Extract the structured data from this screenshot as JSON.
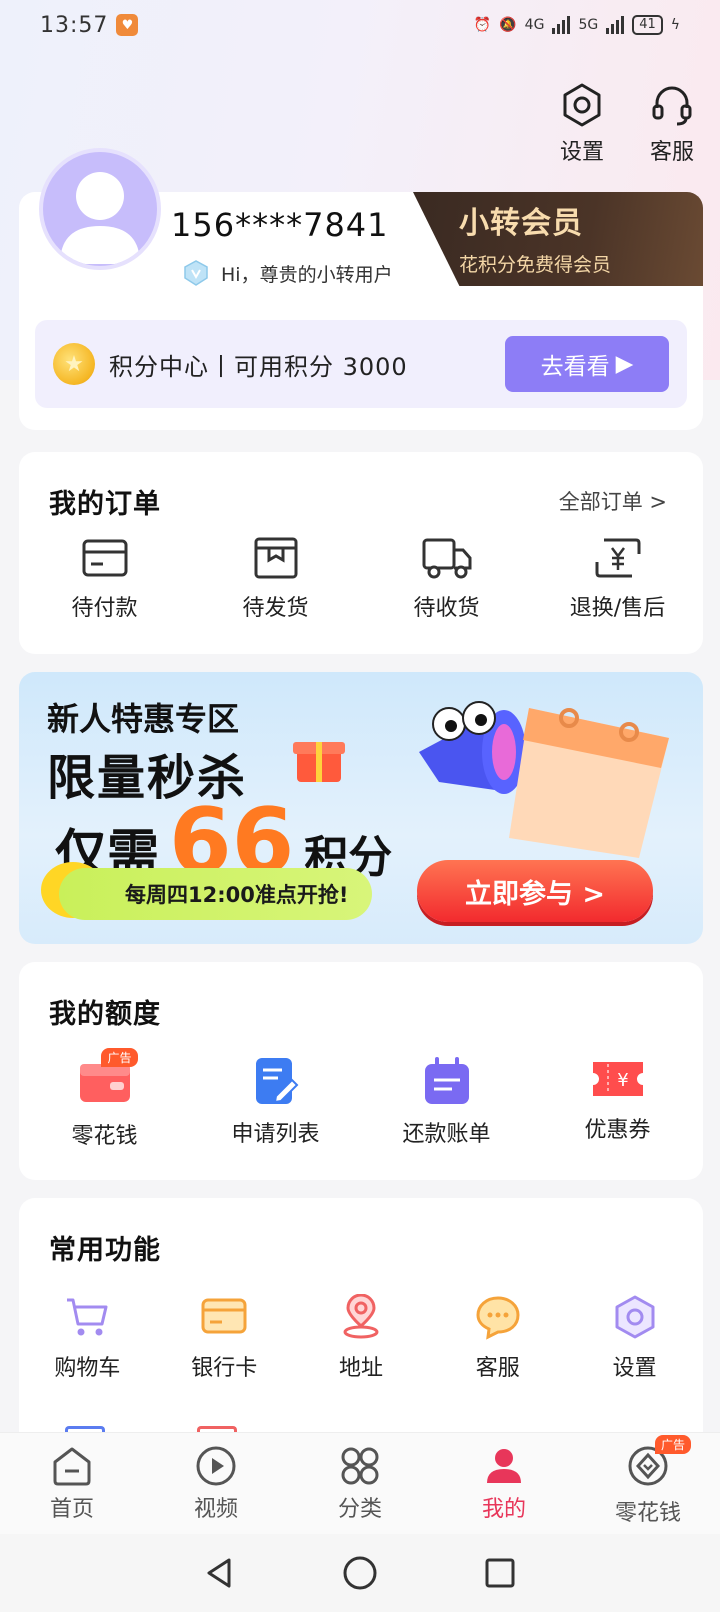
{
  "status_bar": {
    "time": "13:57",
    "battery": "41",
    "net1": "4G",
    "net2": "5G"
  },
  "top_actions": [
    {
      "label": "设置",
      "icon": "gear-icon"
    },
    {
      "label": "客服",
      "icon": "headset-icon"
    }
  ],
  "profile": {
    "phone": "156****7841",
    "greeting": "Hi，尊贵的小转用户",
    "vip_title": "小转会员",
    "vip_subtitle": "花积分免费得会员",
    "points_text": "积分中心丨可用积分 3000",
    "points_button": "去看看"
  },
  "orders": {
    "title": "我的订单",
    "more": "全部订单 >",
    "items": [
      {
        "label": "待付款",
        "icon": "wallet-card-icon"
      },
      {
        "label": "待发货",
        "icon": "package-box-icon"
      },
      {
        "label": "待收货",
        "icon": "delivery-truck-icon"
      },
      {
        "label": "退换/售后",
        "icon": "refund-yen-icon"
      }
    ]
  },
  "promo": {
    "line1": "新人特惠专区",
    "line2": "限量秒杀",
    "line3_prefix": "仅需",
    "line3_number": "66",
    "line3_suffix": "积分",
    "pill": "每周四12:00准点开抢!",
    "cta": "立即参与 >"
  },
  "quota": {
    "title": "我的额度",
    "items": [
      {
        "label": "零花钱",
        "icon": "red-wallet-icon",
        "tag": "广告"
      },
      {
        "label": "申请列表",
        "icon": "edit-document-icon"
      },
      {
        "label": "还款账单",
        "icon": "calendar-bill-icon"
      },
      {
        "label": "优惠券",
        "icon": "coupon-ticket-icon"
      }
    ]
  },
  "functions": {
    "title": "常用功能",
    "items": [
      {
        "label": "购物车",
        "icon": "shopping-cart-icon"
      },
      {
        "label": "银行卡",
        "icon": "bank-card-icon"
      },
      {
        "label": "地址",
        "icon": "location-pin-icon"
      },
      {
        "label": "客服",
        "icon": "chat-bubble-icon"
      },
      {
        "label": "设置",
        "icon": "hexagon-settings-icon"
      }
    ]
  },
  "bottom_nav": [
    {
      "label": "首页",
      "icon": "home-icon"
    },
    {
      "label": "视频",
      "icon": "play-icon"
    },
    {
      "label": "分类",
      "icon": "category-icon"
    },
    {
      "label": "我的",
      "icon": "user-icon",
      "active": true
    },
    {
      "label": "零花钱",
      "icon": "money-icon",
      "tag": "广告"
    }
  ]
}
